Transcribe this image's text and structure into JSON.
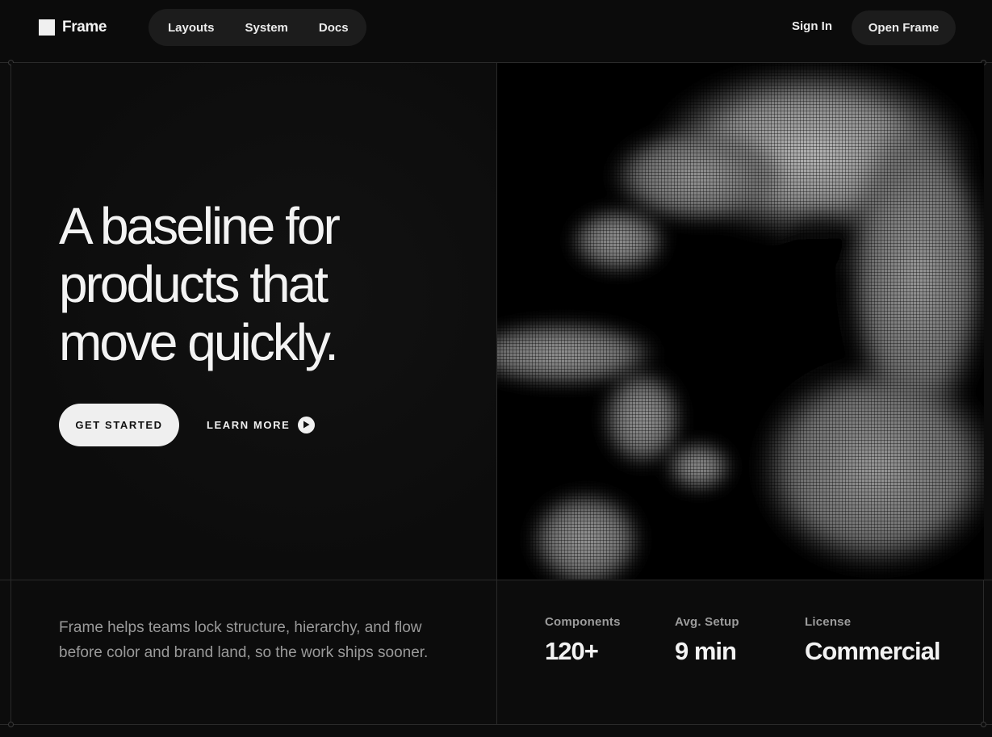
{
  "header": {
    "logo_text": "Frame",
    "nav": [
      {
        "label": "Layouts"
      },
      {
        "label": "System"
      },
      {
        "label": "Docs"
      }
    ],
    "sign_in_label": "Sign In",
    "open_label": "Open Frame"
  },
  "hero": {
    "title_line1": "A baseline for",
    "title_line2": "products that",
    "title_line3": "move quickly.",
    "primary_cta": "GET STARTED",
    "secondary_cta": "LEARN MORE",
    "secondary_icon": "play-icon"
  },
  "footer": {
    "description": "Frame helps teams lock structure, hierarchy, and flow before color and brand land, so the work ships sooner.",
    "stats": [
      {
        "label": "Components",
        "value": "120+"
      },
      {
        "label": "Avg. Setup",
        "value": "9 min"
      },
      {
        "label": "License",
        "value": "Commercial"
      }
    ]
  },
  "colors": {
    "background": "#0c0c0c",
    "surface": "#1c1c1c",
    "text": "#f2f2f2",
    "muted": "#9a9a9a",
    "line": "#2a2a2a"
  }
}
